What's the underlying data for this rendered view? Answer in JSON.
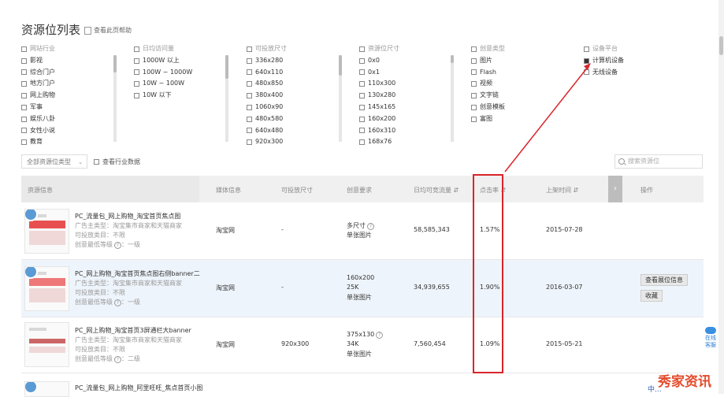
{
  "page": {
    "title": "资源位列表",
    "help_link": "查看此页帮助"
  },
  "filters": {
    "industry": {
      "header": "网站行业",
      "options": [
        "影视",
        "综合门户",
        "地方门户",
        "网上购物",
        "军事",
        "娱乐八卦",
        "女性小说",
        "教育"
      ]
    },
    "visits": {
      "header": "日均访问量",
      "options": [
        "1000W 以上",
        "100W ~ 1000W",
        "10W ~ 100W",
        "10W 以下"
      ]
    },
    "size": {
      "header": "可投放尺寸",
      "options": [
        "336x280",
        "640x110",
        "480x850",
        "380x400",
        "1060x90",
        "480x580",
        "640x480",
        "920x300"
      ]
    },
    "slot_size": {
      "header": "资源位尺寸",
      "options": [
        "0x0",
        "0x1",
        "110x300",
        "130x280",
        "145x165",
        "160x200",
        "160x310",
        "168x76"
      ]
    },
    "creative": {
      "header": "创意类型",
      "options": [
        "图片",
        "Flash",
        "视频",
        "文字链",
        "创意模板",
        "富图"
      ]
    },
    "platform": {
      "header": "设备平台",
      "options": [
        {
          "label": "计算机设备",
          "checked": true
        },
        {
          "label": "无线设备",
          "checked": false
        }
      ]
    }
  },
  "toolbar": {
    "resource_type_select": "全部资源位类型",
    "industry_data_checkbox": "查看行业数据",
    "search_placeholder": "搜索资源位"
  },
  "table": {
    "headers": [
      "资源信息",
      "媒体信息",
      "可投放尺寸",
      "创意要求",
      "日均可竞流量",
      "点击率",
      "上架时间",
      "操作"
    ],
    "rows": [
      {
        "name": "PC_流量包_网上购物_淘宝首页焦点图",
        "owner": "广告主类型：淘宝集市商家和天猫商家",
        "category": "可投放类目：不限",
        "level": "创意最低等级",
        "level_value": "：一级",
        "media": "淘宝网",
        "size": "-",
        "req1": "多尺寸",
        "req2": "单张图片",
        "req3": "",
        "traffic": "58,585,343",
        "ctr": "1.57%",
        "date": "2015-07-28",
        "ops": []
      },
      {
        "name": "PC_网上购物_淘宝首页焦点图右侧banner二",
        "owner": "广告主类型：淘宝集市商家和天猫商家",
        "category": "可投放类目：不限",
        "level": "创意最低等级",
        "level_value": "：一级",
        "media": "淘宝网",
        "size": "-",
        "req1": "160x200",
        "req2": "25K",
        "req3": "单张图片",
        "traffic": "34,939,655",
        "ctr": "1.90%",
        "date": "2016-03-07",
        "ops": [
          "查看展位信息",
          "收藏"
        ]
      },
      {
        "name": "PC_网上购物_淘宝首页3屏通栏大banner",
        "owner": "广告主类型：淘宝集市商家和天猫商家",
        "category": "可投放类目：不限",
        "level": "创意最低等级",
        "level_value": "：二级",
        "media": "淘宝网",
        "size": "920x300",
        "req1": "375x130",
        "req2": "34K",
        "req3": "单张图片",
        "traffic": "7,560,454",
        "ctr": "1.09%",
        "date": "2015-05-21",
        "ops": []
      },
      {
        "name": "PC_流量包_网上购物_阿里旺旺_焦点首页小图",
        "owner": "",
        "category": "",
        "level": "",
        "level_value": "",
        "media": "",
        "size": "",
        "req1": "",
        "req2": "",
        "req3": "",
        "traffic": "",
        "ctr": "",
        "date": "",
        "ops": []
      }
    ]
  },
  "widgets": {
    "online_service": [
      "在线",
      "客服"
    ],
    "watermark": "秀家资讯",
    "watermark_sub": "中..."
  },
  "colors": {
    "highlight_box": "#d9252b",
    "selected_row_bg": "#eef4fb",
    "header_bg": "#f0f0f0"
  },
  "icons": [
    "help-icon",
    "checkbox-icon",
    "chevron-down-icon",
    "search-icon",
    "chevron-right-icon",
    "question-icon",
    "badge-icon",
    "annotation-arrow-icon"
  ]
}
